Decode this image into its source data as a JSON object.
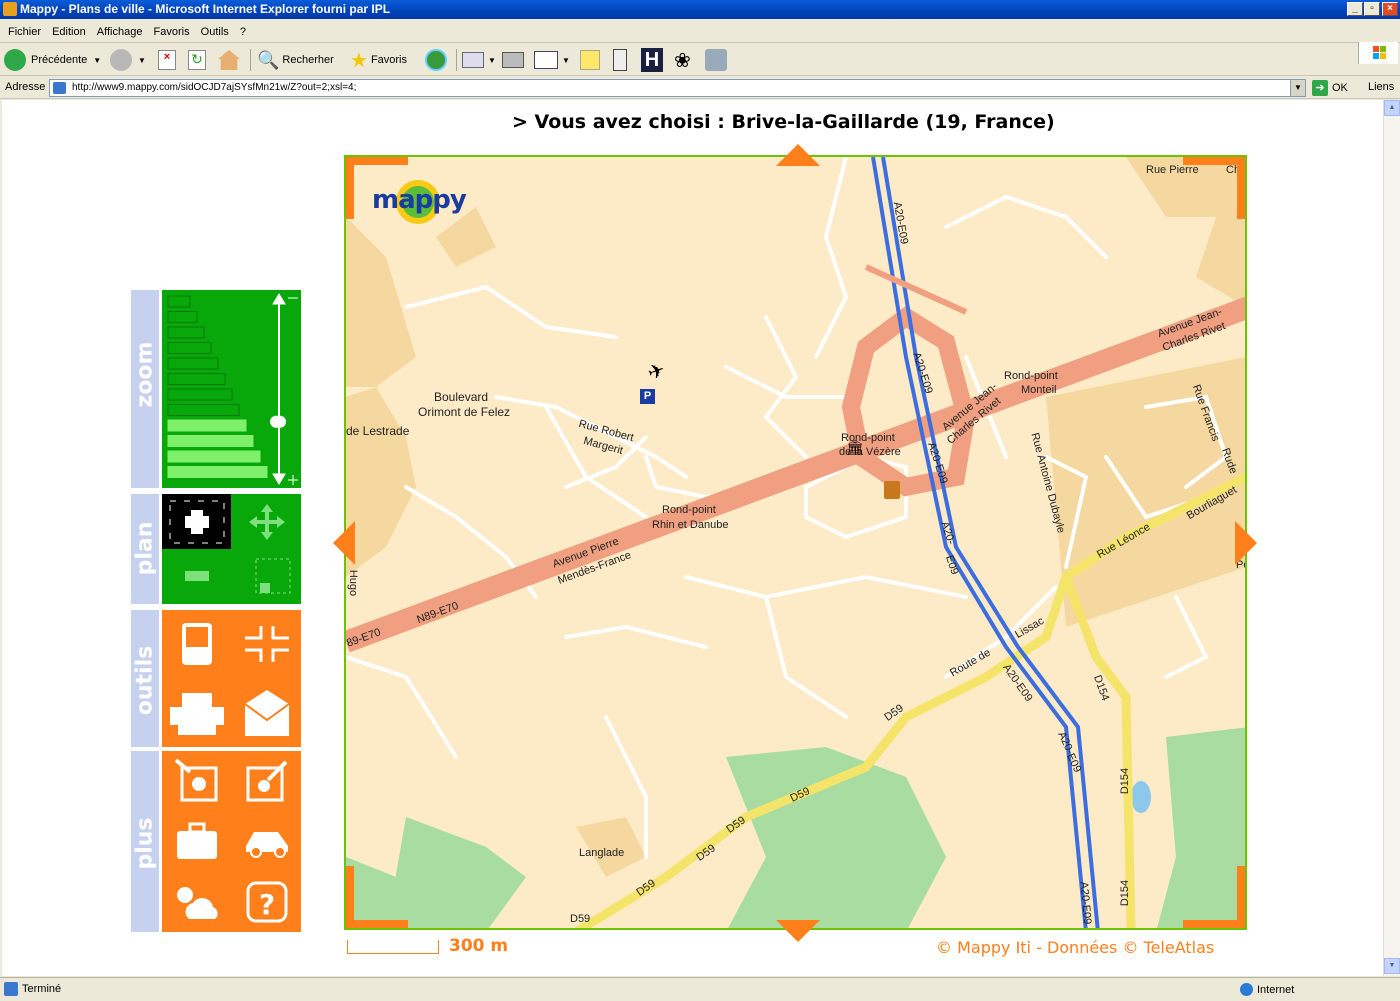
{
  "window": {
    "title": "Mappy - Plans de ville - Microsoft Internet Explorer fourni par IPL"
  },
  "menu": [
    "Fichier",
    "Edition",
    "Affichage",
    "Favoris",
    "Outils",
    "?"
  ],
  "toolbar": {
    "back_label": "Précédente",
    "search_label": "Recherher",
    "favorites_label": "Favoris"
  },
  "address": {
    "label": "Adresse",
    "url": "http://www9.mappy.com/sidOCJD7ajSYsfMn21w/Z?out=2;xsl=4;",
    "go_label": "OK",
    "links_label": "Liens"
  },
  "page": {
    "headline": "> Vous avez choisi :  Brive-la-Gaillarde (19, France)"
  },
  "side_panel": {
    "zoom_label": "zoom",
    "plan_label": "plan",
    "outils_label": "outils",
    "plus_label": "plus",
    "zoom_level": 0.55
  },
  "map": {
    "logo": "mappy",
    "labels": {
      "a20_top": "A20-E09",
      "a20_mid": "A20-E09",
      "a20_mid2": "A20-E09",
      "a20_low": "A20-",
      "a20_low2": "E09",
      "a20_lower": "A20-E09",
      "a20_bottom1": "A20-",
      "a20_bottom2": "E09",
      "a20_end": "A20-E09",
      "rue_pierre": "Rue Pierre",
      "rue_pierre2": "Cha",
      "av_jean1": "Avenue Jean-",
      "av_jean2": "Charles Rivet",
      "av_jean_mid1": "Avenue Jean-",
      "av_jean_mid2": "Charles Rivet",
      "rp_monteil1": "Rond-point",
      "rp_monteil2": "Monteil",
      "boulevard1": "Boulevard",
      "boulevard2": "Orimont de Felez",
      "lestrade": "de Lestrade",
      "rue_robert1": "Rue Robert",
      "rue_robert2": "Margerit",
      "rp_vezere1": "Rond-point",
      "rp_vezere2": "de la Vézère",
      "rp_rhin1": "Rond-point",
      "rp_rhin2": "Rhin et Danube",
      "av_pierre1": "Avenue Pierre",
      "av_pierre2": "Mendès-France",
      "n89": "N89-E70",
      "n89_left": "89-E70",
      "hugo": "Hugo",
      "rue_antoine": "Rue Antoine Dubayle",
      "rue_francis1": "Rue Francis",
      "rue_francis2": "Rude",
      "rue_leonce": "Rue Léonce",
      "bourliaguet": "Bourliaguet",
      "route_lissac1": "Route de",
      "route_lissac2": "Lissac",
      "d59_1": "D59",
      "d59_2": "D59",
      "d59_3": "D59",
      "d59_4": "D59",
      "d59_5": "D59",
      "d59_6": "D59",
      "d154_1": "D154",
      "d154_2": "D154",
      "d154_3": "D154",
      "langlade": "Langlade",
      "ri": "Ri",
      "pe": "Pe"
    }
  },
  "scale": {
    "label": "300 m"
  },
  "copyright": "© Mappy Iti - Données © TeleAtlas",
  "status": {
    "text": "Terminé",
    "zone": "Internet"
  },
  "colors": {
    "accent_orange": "#ff7f1a",
    "panel_green": "#08a80a",
    "tab_blue": "#c6d1ef",
    "map_border": "#6cc400"
  }
}
